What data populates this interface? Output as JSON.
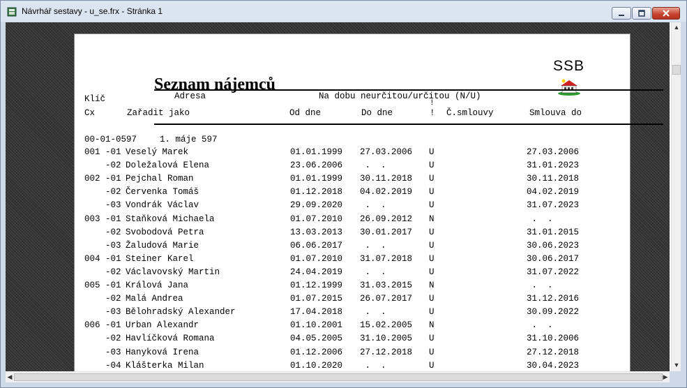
{
  "window": {
    "title": "Návrhář sestavy - u_se.frx - Stránka 1"
  },
  "report": {
    "title": "Seznam nájemců",
    "logo_text": "SSB",
    "headers": {
      "klic": "Klíč",
      "adresa": "Adresa",
      "na_dobu": "Na dobu neurčitou/určitou (N/U)",
      "excl_top": "!",
      "cx": "Cx",
      "zaradit": "Zařadit jako",
      "od_dne": "Od dne",
      "do_dne": "Do dne",
      "excl": "!",
      "c_smlouvy": "Č.smlouvy",
      "smlouva_do": "Smlouva do"
    },
    "group_line": {
      "key": "00-01-0597",
      "address": "1. máje 597"
    },
    "rows": [
      {
        "code": "001 -01",
        "name": "Veselý Marek",
        "od": "01.01.1999",
        "do": "27.03.2006",
        "nu": "U",
        "smlouva_do": "27.03.2006"
      },
      {
        "code": "    -02",
        "name": "Doležalová Elena",
        "od": "23.06.2006",
        "do": " .  .",
        "nu": "U",
        "smlouva_do": "31.01.2023"
      },
      {
        "code": "002 -01",
        "name": "Pejchal Roman",
        "od": "01.01.1999",
        "do": "30.11.2018",
        "nu": "U",
        "smlouva_do": "30.11.2018"
      },
      {
        "code": "    -02",
        "name": "Červenka Tomáš",
        "od": "01.12.2018",
        "do": "04.02.2019",
        "nu": "U",
        "smlouva_do": "04.02.2019"
      },
      {
        "code": "    -03",
        "name": "Vondrák Václav",
        "od": "29.09.2020",
        "do": " .  .",
        "nu": "U",
        "smlouva_do": "31.07.2023"
      },
      {
        "code": "003 -01",
        "name": "Staňková Michaela",
        "od": "01.07.2010",
        "do": "26.09.2012",
        "nu": "N",
        "smlouva_do": " .  ."
      },
      {
        "code": "    -02",
        "name": "Svobodová Petra",
        "od": "13.03.2013",
        "do": "30.01.2017",
        "nu": "U",
        "smlouva_do": "31.01.2015"
      },
      {
        "code": "    -03",
        "name": "Žaludová Marie",
        "od": "06.06.2017",
        "do": " .  .",
        "nu": "U",
        "smlouva_do": "30.06.2023"
      },
      {
        "code": "004 -01",
        "name": "Steiner Karel",
        "od": "01.07.2010",
        "do": "31.07.2018",
        "nu": "U",
        "smlouva_do": "30.06.2017"
      },
      {
        "code": "    -02",
        "name": "Václavovský Martin",
        "od": "24.04.2019",
        "do": " .  .",
        "nu": "U",
        "smlouva_do": "31.07.2022"
      },
      {
        "code": "005 -01",
        "name": "Králová Jana",
        "od": "01.12.1999",
        "do": "31.03.2015",
        "nu": "N",
        "smlouva_do": " .  ."
      },
      {
        "code": "    -02",
        "name": "Malá Andrea",
        "od": "01.07.2015",
        "do": "26.07.2017",
        "nu": "U",
        "smlouva_do": "31.12.2016"
      },
      {
        "code": "    -03",
        "name": "Bělohradský Alexander",
        "od": "17.04.2018",
        "do": " .  .",
        "nu": "U",
        "smlouva_do": "30.09.2022"
      },
      {
        "code": "006 -01",
        "name": "Urban Alexandr",
        "od": "01.10.2001",
        "do": "15.02.2005",
        "nu": "N",
        "smlouva_do": " .  ."
      },
      {
        "code": "    -02",
        "name": "Havlíčková Romana",
        "od": "04.05.2005",
        "do": "31.10.2005",
        "nu": "U",
        "smlouva_do": "31.10.2006"
      },
      {
        "code": "    -03",
        "name": "Hanyková Irena",
        "od": "01.12.2006",
        "do": "27.12.2018",
        "nu": "U",
        "smlouva_do": "27.12.2018"
      },
      {
        "code": "    -04",
        "name": "Klášterka Milan",
        "od": "01.10.2020",
        "do": " .  .",
        "nu": "U",
        "smlouva_do": "30.04.2023"
      }
    ]
  },
  "colors": {
    "close_button": "#c5402c",
    "canvas": "#2d2d2d"
  }
}
